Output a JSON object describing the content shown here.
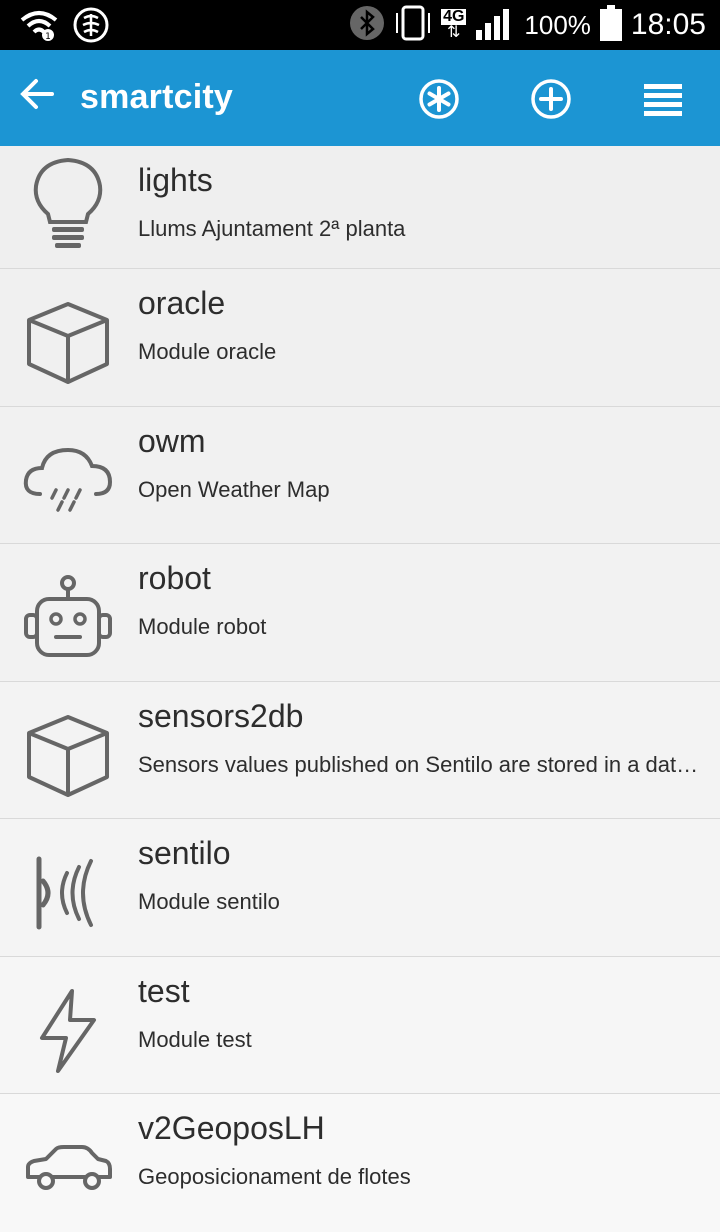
{
  "status_bar": {
    "network_type": "4G",
    "battery_percent": "100%",
    "time": "18:05"
  },
  "app_bar": {
    "title": "smartcity",
    "actions": [
      {
        "icon": "asterisk-icon"
      },
      {
        "icon": "add-circle-icon"
      },
      {
        "icon": "menu-icon"
      }
    ]
  },
  "modules": [
    {
      "name": "lights",
      "description": "Llums Ajuntament 2ª planta",
      "icon": "lightbulb-icon"
    },
    {
      "name": "oracle",
      "description": "Module oracle",
      "icon": "cube-icon"
    },
    {
      "name": "owm",
      "description": "Open Weather Map",
      "icon": "rain-cloud-icon"
    },
    {
      "name": "robot",
      "description": "Module robot",
      "icon": "robot-icon"
    },
    {
      "name": "sensors2db",
      "description": "Sensors values published on Sentilo are stored in a database",
      "icon": "cube-icon"
    },
    {
      "name": "sentilo",
      "description": "Module sentilo",
      "icon": "signal-waves-icon"
    },
    {
      "name": "test",
      "description": "Module test",
      "icon": "lightning-icon"
    },
    {
      "name": "v2GeoposLH",
      "description": "Geoposicionament de flotes",
      "icon": "car-icon"
    }
  ],
  "colors": {
    "app_bar": "#1c95d3",
    "list_bg": "#f4f4f4",
    "icon_stroke": "#666666",
    "text": "#2d2d2d"
  }
}
